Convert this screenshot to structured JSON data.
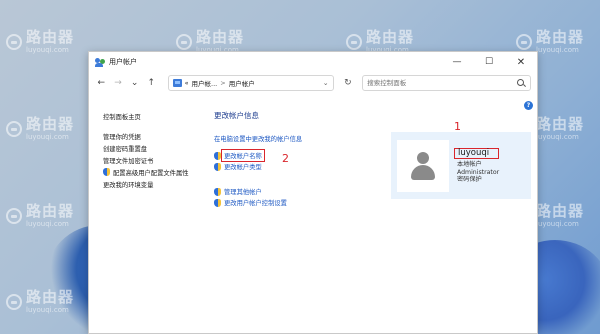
{
  "watermark": {
    "brand": "路由器",
    "domain": "luyouqi.com"
  },
  "window": {
    "title": "用户帐户",
    "controls": {
      "minimize": "—",
      "maximize": "☐",
      "close": "✕"
    }
  },
  "navbar": {
    "back": "←",
    "forward": "→",
    "dropdown": "⌄",
    "up": "↑",
    "address_prefix": "«",
    "address_parts": [
      "用户帐...",
      "用户帐户"
    ],
    "address_separator": ">",
    "address_dropdown": "⌄",
    "refresh": "↻",
    "search_placeholder": "搜索控制面板"
  },
  "help": {
    "label": "?"
  },
  "left_pane": {
    "items": [
      {
        "label": "控制面板主页",
        "shield": false
      },
      {
        "label": "管理你的凭据",
        "shield": false
      },
      {
        "label": "创建密码重置盘",
        "shield": false
      },
      {
        "label": "管理文件加密证书",
        "shield": false
      },
      {
        "label": "配置高级用户配置文件属性",
        "shield": true
      },
      {
        "label": "更改我的环境变量",
        "shield": false
      }
    ]
  },
  "main": {
    "heading": "更改帐户信息",
    "links": {
      "pc_settings": "在电脑设置中更改我的帐户信息",
      "change_name": "更改帐户名称",
      "change_type": "更改帐户类型",
      "manage_other": "管理其他帐户",
      "uac_settings": "更改用户帐户控制设置"
    }
  },
  "user": {
    "name": "luyouqi",
    "account_type": "本地帐户",
    "role": "Administrator",
    "protection": "密码保护"
  },
  "annotations": {
    "one": "1",
    "two": "2"
  },
  "colors": {
    "accent_link": "#1a56c2",
    "heading": "#1e3d8f",
    "highlight_red": "#d9262c",
    "user_panel_bg": "#e8f2fc"
  }
}
